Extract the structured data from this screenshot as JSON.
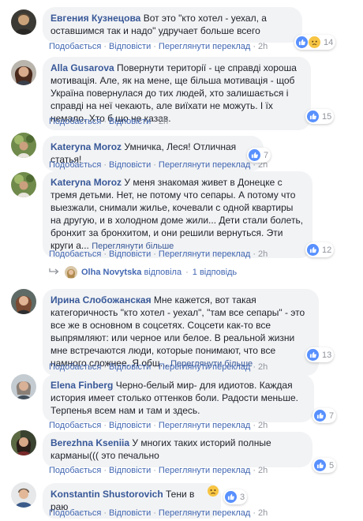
{
  "actions": {
    "like": "Подобається",
    "reply": "Відповісти",
    "translate": "Переглянути переклад",
    "more": "Переглянути більше"
  },
  "comments": [
    {
      "author": "Евгения Кузнецова",
      "text": "Вот это \"кто хотел - уехал, а оставшимся так и надо\" удручает больше всего",
      "time": "2h",
      "reactions": "14",
      "avatar": "avatar-photo"
    },
    {
      "author": "Alla Gusarova",
      "text": "Повернути території - це справді хороша мотивація. Але, як на мене, ще більша мотивація - щоб Україна повернулася до тих людей, хто залишається і справді на неї чекають, але виїхати не можуть. І їх немало. Хто б що не казав.",
      "time": "2h",
      "reactions": "15",
      "avatar": "avatar-photo"
    },
    {
      "author": "Kateryna Moroz",
      "text": "Умничка, Леся! Отличная статья!",
      "time": "2h",
      "reactions": "7",
      "avatar": "avatar-photo"
    },
    {
      "author": "Kateryna Moroz",
      "text": "У меня знакомая живет в Донецке с тремя детьми. Нет, не потому что сепары. А потому что выезжали, снимали жилье, кочевали с одной квартиры на другую, и в холодном доме жили... Дети стали болеть, бронхит за бронхитом, и они решили вернуться. Эти круги а...",
      "time": "2h",
      "reactions": "12",
      "avatar": "avatar-photo",
      "reply_summary": {
        "name": "Olha Novytska",
        "verb": "відповіла",
        "count": "1 відповідь"
      }
    },
    {
      "author": "Ирина Слобожанская",
      "text": "Мне кажется, вот такая категоричность \"кто хотел - уехал\", \"там все сепары\" - это все же в основном в соцсетях. Соцсети как-то все выпрямляют: или черное или белое. В реальной жизни мне встречаются люди, которые понимают, что все намного сложнее. Я общ...",
      "time": "2h",
      "reactions": "13",
      "avatar": "avatar-photo"
    },
    {
      "author": "Elena Finberg",
      "text": "Черно-белый мир- для идиотов. Каждая история имеет столько оттенков боли. Радости меньше. Терпенья всем нам и там и здесь.",
      "time": "2h",
      "reactions": "7",
      "avatar": "avatar-photo"
    },
    {
      "author": "Berezhna Kseniia",
      "text": "У многих таких историй полные карманы((( это печально",
      "time": "2h",
      "reactions": "5",
      "avatar": "avatar-photo"
    },
    {
      "author": "Konstantin Shustorovich",
      "text": "Тени в раю",
      "time": "2h",
      "reactions": "3",
      "avatar": "avatar-photo"
    }
  ],
  "colors": {
    "link": "#385898",
    "action": "#4267b2",
    "muted": "#90949c",
    "bubble": "#f2f3f5",
    "like": "#5890ff",
    "sad": "#f7c543"
  }
}
